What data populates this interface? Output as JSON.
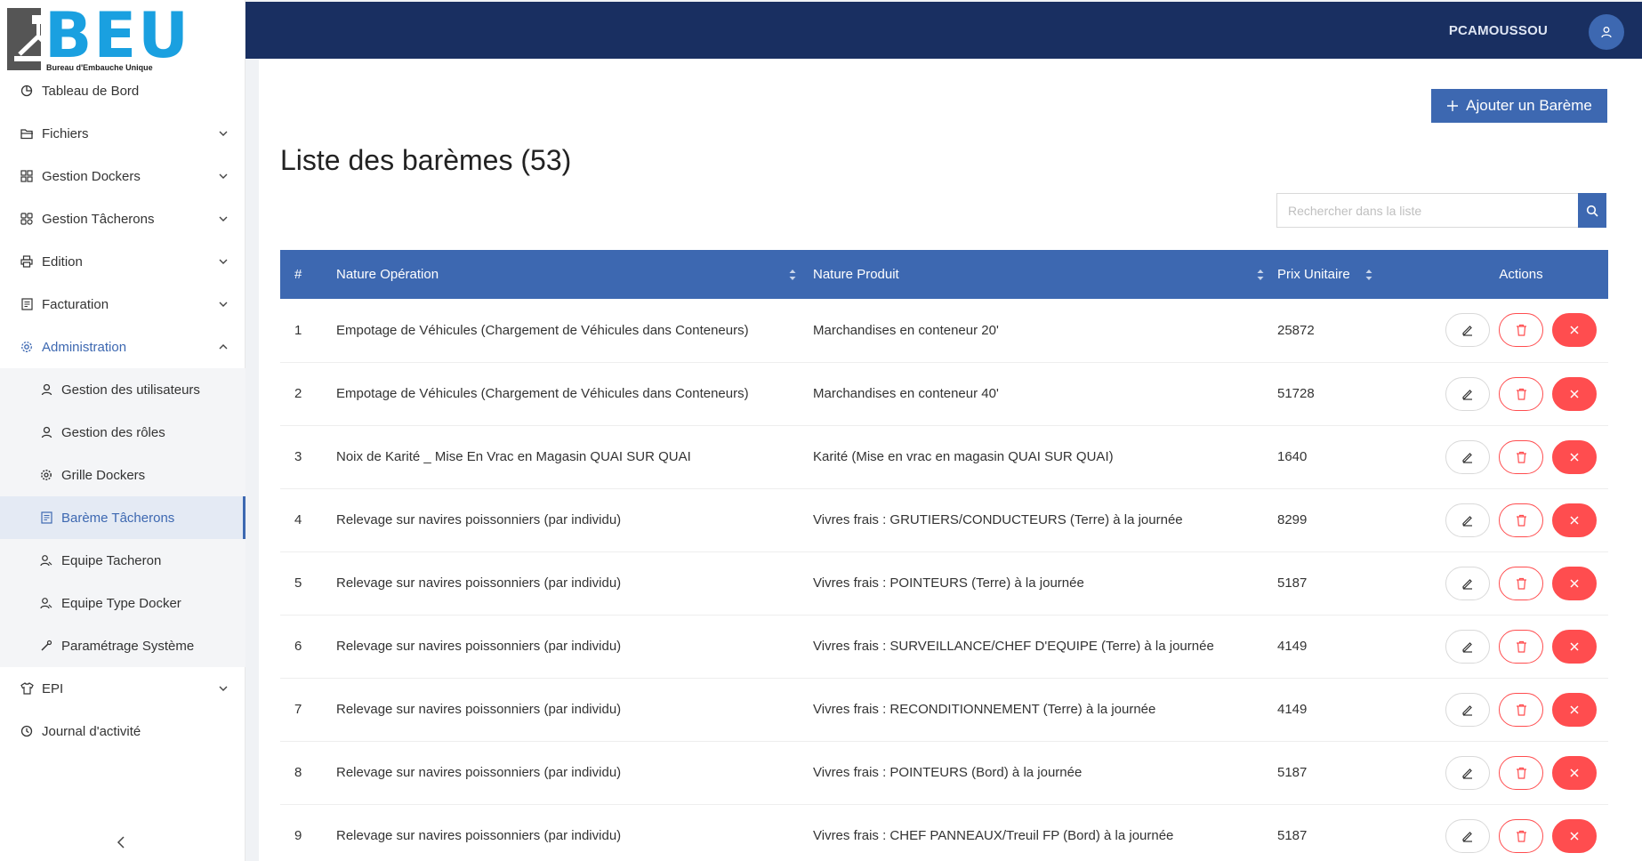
{
  "brand": {
    "name": "BEU",
    "tagline": "Bureau d'Embauche Unique"
  },
  "user": {
    "name": "PCAMOUSSOU"
  },
  "sidebar": {
    "items": [
      {
        "label": "Tableau de Bord",
        "icon": "dashboard-icon"
      },
      {
        "label": "Fichiers",
        "icon": "folder-icon"
      },
      {
        "label": "Gestion Dockers",
        "icon": "apps-icon"
      },
      {
        "label": "Gestion Tâcherons",
        "icon": "build-icon"
      },
      {
        "label": "Edition",
        "icon": "printer-icon"
      },
      {
        "label": "Facturation",
        "icon": "invoice-icon"
      },
      {
        "label": "Administration",
        "icon": "gear-icon"
      },
      {
        "label": "EPI",
        "icon": "shirt-icon"
      },
      {
        "label": "Journal d'activité",
        "icon": "history-icon"
      }
    ],
    "admin_sub": [
      {
        "label": "Gestion des utilisateurs",
        "icon": "user-icon"
      },
      {
        "label": "Gestion des rôles",
        "icon": "user-icon"
      },
      {
        "label": "Grille Dockers",
        "icon": "gear-icon"
      },
      {
        "label": "Barème Tâcherons",
        "icon": "invoice-icon"
      },
      {
        "label": "Equipe Tacheron",
        "icon": "team-icon"
      },
      {
        "label": "Equipe Type Docker",
        "icon": "team-icon"
      },
      {
        "label": "Paramétrage Système",
        "icon": "tool-icon"
      }
    ]
  },
  "main": {
    "add_button": "Ajouter un Barème",
    "title": "Liste des barèmes (53)",
    "search_placeholder": "Rechercher dans la liste",
    "columns": [
      "#",
      "Nature Opération",
      "Nature Produit",
      "Prix Unitaire",
      "Actions"
    ],
    "rows": [
      {
        "n": "1",
        "op": "Empotage de Véhicules (Chargement de Véhicules dans Conteneurs)",
        "prod": "Marchandises en conteneur 20'",
        "price": "25872"
      },
      {
        "n": "2",
        "op": "Empotage de Véhicules (Chargement de Véhicules dans Conteneurs)",
        "prod": "Marchandises en conteneur 40'",
        "price": "51728"
      },
      {
        "n": "3",
        "op": "Noix de Karité _ Mise En Vrac en Magasin QUAI SUR QUAI",
        "prod": "Karité (Mise en vrac en magasin QUAI SUR QUAI)",
        "price": "1640"
      },
      {
        "n": "4",
        "op": "Relevage sur navires poissonniers (par individu)",
        "prod": "Vivres frais : GRUTIERS/CONDUCTEURS (Terre) à la journée",
        "price": "8299"
      },
      {
        "n": "5",
        "op": "Relevage sur navires poissonniers (par individu)",
        "prod": "Vivres frais : POINTEURS (Terre) à la journée",
        "price": "5187"
      },
      {
        "n": "6",
        "op": "Relevage sur navires poissonniers (par individu)",
        "prod": "Vivres frais : SURVEILLANCE/CHEF D'EQUIPE (Terre) à la journée",
        "price": "4149"
      },
      {
        "n": "7",
        "op": "Relevage sur navires poissonniers (par individu)",
        "prod": "Vivres frais : RECONDITIONNEMENT (Terre) à la journée",
        "price": "4149"
      },
      {
        "n": "8",
        "op": "Relevage sur navires poissonniers (par individu)",
        "prod": "Vivres frais : POINTEURS (Bord) à la journée",
        "price": "5187"
      },
      {
        "n": "9",
        "op": "Relevage sur navires poissonniers (par individu)",
        "prod": "Vivres frais : CHEF PANNEAUX/Treuil FP (Bord) à la journée",
        "price": "5187"
      }
    ]
  },
  "colors": {
    "primary": "#3d68b1",
    "topbar": "#192f61",
    "danger": "#ff4d4f",
    "logo": "#1aa0e0"
  }
}
